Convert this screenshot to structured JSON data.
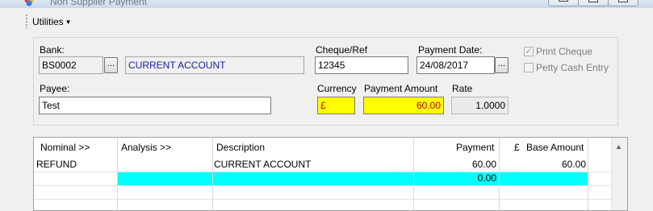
{
  "window": {
    "title": "Non Supplier Payment"
  },
  "menu": {
    "utilities_label": "Utilities"
  },
  "header": {
    "bank_label": "Bank:",
    "bank_code": "BS0002",
    "bank_browse": "...",
    "bank_name": "CURRENT ACCOUNT",
    "cheque_label": "Cheque/Ref",
    "cheque_value": "12345",
    "payment_date_label": "Payment Date:",
    "payment_date_value": "24/08/2017",
    "date_browse": "...",
    "print_cheque_label": "Print Cheque",
    "print_cheque_checked": true,
    "petty_cash_label": "Petty Cash Entry",
    "petty_cash_checked": false,
    "payee_label": "Payee:",
    "payee_value": "Test",
    "currency_label": "Currency",
    "currency_value": "£",
    "payment_amount_label": "Payment Amount",
    "payment_amount_value": "60.00",
    "rate_label": "Rate",
    "rate_value": "1.0000",
    "highlight_color": "#ffff00"
  },
  "grid": {
    "columns": {
      "nominal": "Nominal >>",
      "analysis": "Analysis >>",
      "description": "Description",
      "payment": "Payment",
      "currency_symbol": "£",
      "base_amount": "Base Amount"
    },
    "rows": [
      {
        "nominal": "REFUND",
        "analysis": "",
        "description": "CURRENT ACCOUNT",
        "payment": "60.00",
        "base_amount": "60.00"
      },
      {
        "nominal": "",
        "analysis": "",
        "description": "",
        "payment": "0.00",
        "base_amount": ""
      }
    ],
    "selected_row_color": "#00ffff"
  }
}
